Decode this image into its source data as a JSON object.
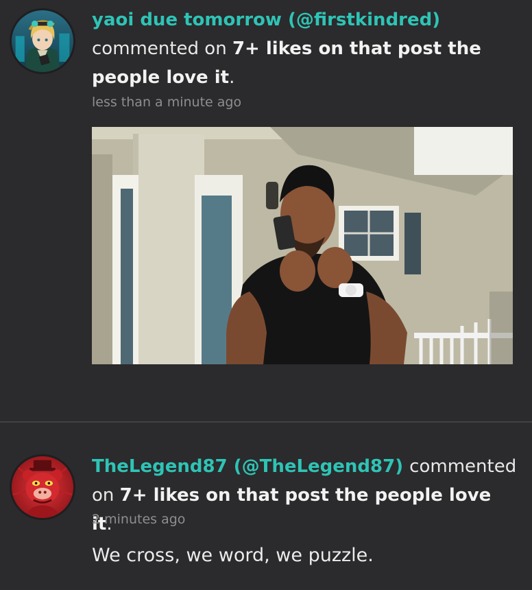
{
  "feed": [
    {
      "display_name": "yaoi due tomorrow",
      "handle": "(@firstkindred)",
      "action": "commented on",
      "post_title": "7+ likes on that post the people love it",
      "period": ".",
      "timestamp": "less than a minute ago",
      "avatar_icon": "anime-character-avatar"
    },
    {
      "display_name": "TheLegend87",
      "handle": "(@TheLegend87)",
      "action": "commented on",
      "post_title": "7+ likes on that post the people love it",
      "period": ".",
      "timestamp": "2 minutes ago",
      "comment": "We cross, we word, we puzzle.",
      "avatar_icon": "red-bear-avatar"
    }
  ],
  "colors": {
    "background": "#2b2a2c",
    "username": "#2ec4b6",
    "timestamp": "#8f8d91",
    "divider": "#434145"
  }
}
